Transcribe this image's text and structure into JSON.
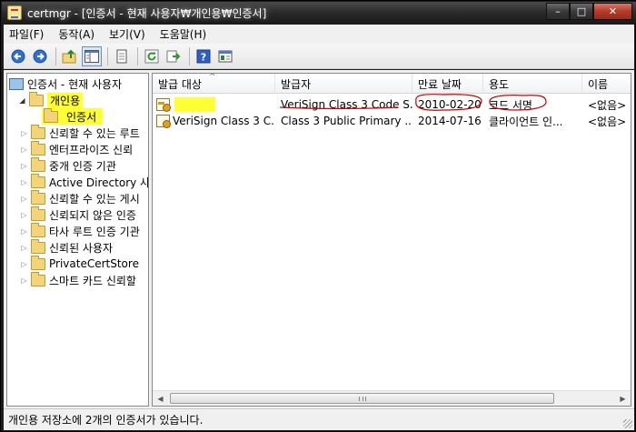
{
  "window": {
    "title": "certmgr - [인증서 - 현재 사용자₩개인용₩인증서]",
    "controls": {
      "minimize": "–",
      "maximize": "□",
      "close": "✕"
    }
  },
  "menu": {
    "items": [
      "파일(F)",
      "동작(A)",
      "보기(V)",
      "도움말(H)"
    ]
  },
  "toolbar": {
    "buttons": [
      "back-icon",
      "forward-icon",
      "up-folder-icon",
      "show-hide-tree-icon",
      "copy-icon",
      "refresh-icon",
      "export-list-icon",
      "help-icon",
      "properties-icon"
    ]
  },
  "tree": {
    "root": "인증서 - 현재 사용자",
    "items": [
      {
        "label": "개인용",
        "expanded": true,
        "highlighted": true
      },
      {
        "label": "인증서",
        "child": true,
        "highlighted": true
      },
      {
        "label": "신뢰할 수 있는 루트"
      },
      {
        "label": "엔터프라이즈 신뢰"
      },
      {
        "label": "중개 인증 기관"
      },
      {
        "label": "Active Directory 사용"
      },
      {
        "label": "신뢰할 수 있는 게시"
      },
      {
        "label": "신뢰되지 않은 인증"
      },
      {
        "label": "타사 루트 인증 기관"
      },
      {
        "label": "신뢰된 사용자"
      },
      {
        "label": "PrivateCertStore"
      },
      {
        "label": "스마트 카드 신뢰할"
      }
    ]
  },
  "list": {
    "columns": [
      "발급 대상",
      "발급자",
      "만료 날짜",
      "용도",
      "이름"
    ],
    "sort_indicator": "^",
    "rows": [
      {
        "issued_to": "",
        "issued_by": "VeriSign Class 3 Code S...",
        "expiration": "2010-02-20",
        "purpose": "코드 서명",
        "name": "<없음>"
      },
      {
        "issued_to": "VeriSign Class 3 C...",
        "issued_by": "Class 3 Public Primary ...",
        "expiration": "2014-07-16",
        "purpose": "클라이언트 인...",
        "name": "<없음>"
      }
    ]
  },
  "status": {
    "text": "개인용 저장소에 2개의 인증서가 있습니다."
  },
  "colors": {
    "highlight": "#ffff33",
    "annotation_red": "#cc0000",
    "title_bar": "#2a2a2a"
  }
}
